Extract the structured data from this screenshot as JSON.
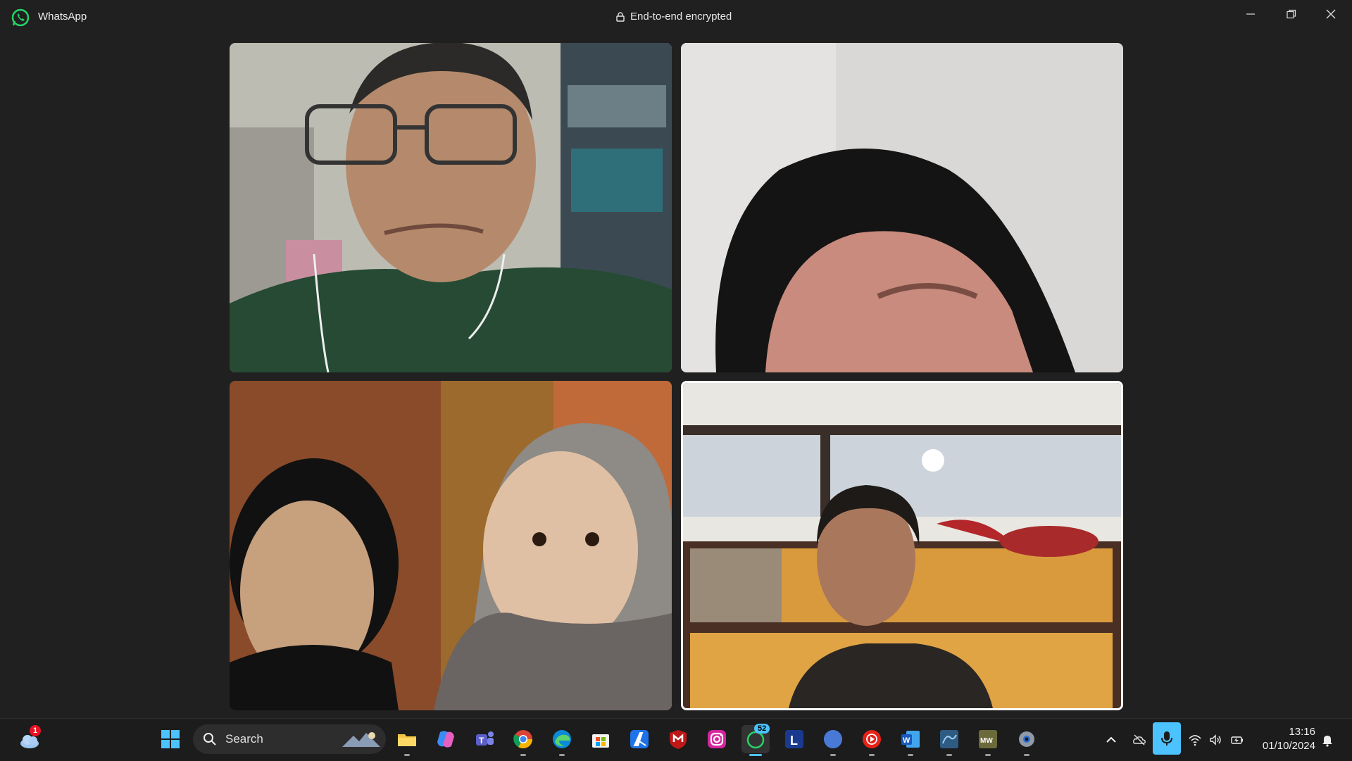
{
  "window": {
    "app_name": "WhatsApp",
    "encryption_label": "End-to-end encrypted",
    "controls": [
      "minimize",
      "restore",
      "close"
    ]
  },
  "call": {
    "participants": [
      {
        "tile": 1,
        "description": "participant-video",
        "active_speaker": false
      },
      {
        "tile": 2,
        "description": "participant-video",
        "active_speaker": false
      },
      {
        "tile": 3,
        "description": "participant-video",
        "active_speaker": false
      },
      {
        "tile": 4,
        "description": "participant-video",
        "active_speaker": true
      }
    ]
  },
  "taskbar": {
    "weather_badge": "1",
    "search_label": "Search",
    "whatsapp_badge": "52",
    "pinned_apps": [
      "start-icon",
      "file-explorer-icon",
      "copilot-icon",
      "teams-icon",
      "chrome-icon",
      "edge-icon",
      "store-icon",
      "app-a-icon",
      "mcafee-icon",
      "instagram-icon",
      "whatsapp-icon",
      "l-app-icon",
      "canva-icon",
      "youtube-music-icon",
      "word-icon",
      "mysql-workbench-icon",
      "mw-app-icon",
      "settings-icon"
    ],
    "tray": {
      "time": "13:16",
      "date": "01/10/2024"
    },
    "accent_color": "#4cc2ff"
  }
}
